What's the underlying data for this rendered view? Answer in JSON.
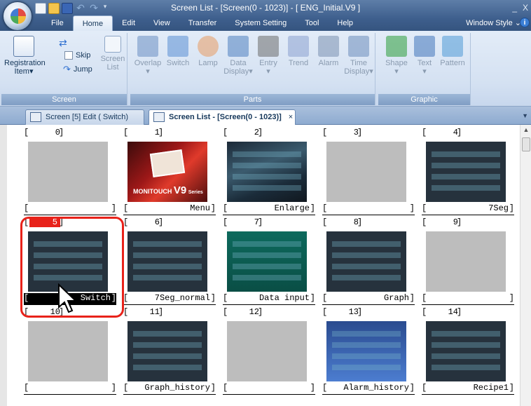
{
  "window": {
    "title": "Screen List - [Screen(0 - 1023)] - [ ENG_Initial.V9 ]",
    "minimize": "_",
    "close": "X"
  },
  "menu_tabs": [
    "File",
    "Home",
    "Edit",
    "View",
    "Transfer",
    "System Setting",
    "Tool",
    "Help"
  ],
  "window_style": "Window Style",
  "ribbon": {
    "screen_group": {
      "label": "Screen",
      "registration": [
        "Registration",
        "Item"
      ],
      "skip": "Skip",
      "jump": "Jump",
      "screen_list": [
        "Screen",
        "List"
      ]
    },
    "parts_group": {
      "label": "Parts",
      "items": [
        {
          "label": "Overlap",
          "label2": ""
        },
        {
          "label": "Switch",
          "label2": ""
        },
        {
          "label": "Lamp",
          "label2": ""
        },
        {
          "label": "Data",
          "label2": "Display"
        },
        {
          "label": "Entry",
          "label2": ""
        },
        {
          "label": "Trend",
          "label2": ""
        },
        {
          "label": "Alarm",
          "label2": ""
        },
        {
          "label": "Time",
          "label2": "Display"
        }
      ]
    },
    "graphic_group": {
      "label": "Graphic",
      "items": [
        "Shape",
        "Text",
        "Pattern"
      ]
    }
  },
  "doc_tabs": [
    {
      "label": "Screen [5] Edit (        Switch)",
      "active": false
    },
    {
      "label": "Screen List - [Screen(0 - 1023)]",
      "active": true,
      "close": "×"
    }
  ],
  "screens": [
    {
      "num": "0",
      "name": ""
    },
    {
      "num": "1",
      "name": "Menu"
    },
    {
      "num": "2",
      "name": "Enlarge"
    },
    {
      "num": "3",
      "name": ""
    },
    {
      "num": "4",
      "name": "7Seg"
    },
    {
      "num": "5",
      "name": "Switch",
      "selected": true
    },
    {
      "num": "6",
      "name": "7Seg_normal"
    },
    {
      "num": "7",
      "name": "Data input"
    },
    {
      "num": "8",
      "name": "Graph"
    },
    {
      "num": "9",
      "name": ""
    },
    {
      "num": "10",
      "name": ""
    },
    {
      "num": "11",
      "name": "Graph_history"
    },
    {
      "num": "12",
      "name": ""
    },
    {
      "num": "13",
      "name": "Alarm_history"
    },
    {
      "num": "14",
      "name": "Recipe1"
    }
  ],
  "thumb_text": {
    "menu_brand": "MONITOUCH",
    "menu_model": "V9",
    "menu_series": "Series"
  },
  "colors": {
    "highlight": "#e8221a",
    "accent": "#3e5f8d"
  }
}
